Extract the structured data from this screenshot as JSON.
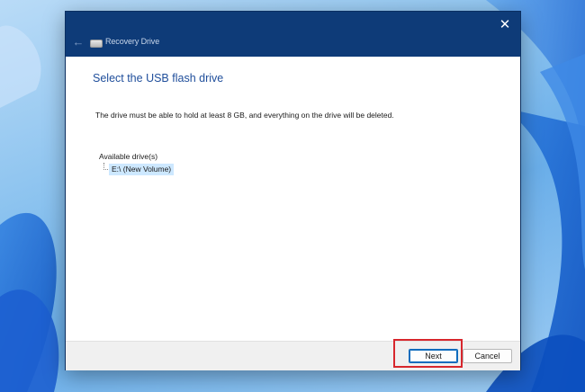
{
  "window": {
    "title": "Recovery Drive",
    "close_glyph": "✕",
    "back_glyph": "←",
    "app_icon": "drive-icon",
    "back_icon": "back-arrow-icon",
    "close_icon": "close-icon"
  },
  "content": {
    "heading": "Select the USB flash drive",
    "description": "The drive must be able to hold at least 8 GB, and everything on the drive will be deleted.",
    "drives_label": "Available drive(s)",
    "drives": [
      {
        "label": "E:\\ (New Volume)",
        "selected": true
      }
    ]
  },
  "footer": {
    "next_label": "Next",
    "cancel_label": "Cancel"
  },
  "colors": {
    "titlebar": "#0e3b78",
    "heading": "#1f4e9b",
    "selection": "#cde8ff",
    "highlight": "#d7272d"
  }
}
